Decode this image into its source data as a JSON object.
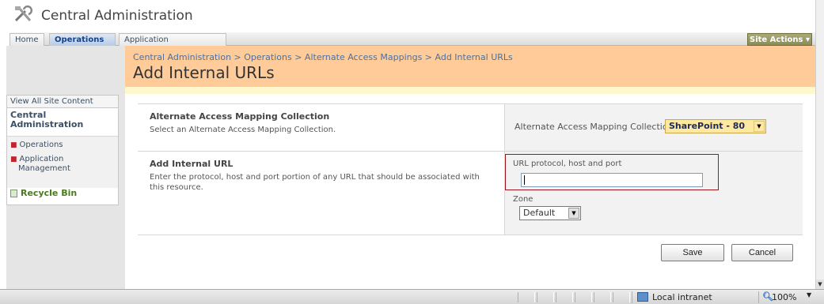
{
  "header": {
    "site_title": "Central Administration",
    "logo_icon": "tools-icon"
  },
  "topnav": {
    "tabs": [
      {
        "label": "Home",
        "active": false
      },
      {
        "label": "Operations",
        "active": true
      },
      {
        "label": "Application Management",
        "active": false
      }
    ],
    "site_actions": "Site Actions ▾"
  },
  "quicklaunch": {
    "view_all": "View All Site Content",
    "section_title": "Central Administration",
    "items": [
      "Operations",
      "Application Management"
    ],
    "recycle_bin": "Recycle Bin"
  },
  "title_area": {
    "breadcrumb": "Central Administration > Operations > Alternate Access Mappings > Add Internal URLs",
    "page_title": "Add Internal URLs"
  },
  "form": {
    "collection_section": {
      "title": "Alternate Access Mapping Collection",
      "description": "Select an Alternate Access Mapping Collection.",
      "field_label": "Alternate Access Mapping Collection:",
      "selected": "SharePoint - 80"
    },
    "url_section": {
      "title": "Add Internal URL",
      "description": "Enter the protocol, host and port portion of any URL that should be associated with this resource.",
      "url_label": "URL protocol, host and port",
      "url_value": "",
      "zone_label": "Zone",
      "zone_selected": "Default"
    },
    "save_label": "Save",
    "cancel_label": "Cancel"
  },
  "statusbar": {
    "zone": "Local intranet",
    "zoom": "100%"
  },
  "colors": {
    "title_band": "#ffcc99",
    "accent_red": "#a0151b",
    "site_actions": "#8b8c55"
  }
}
